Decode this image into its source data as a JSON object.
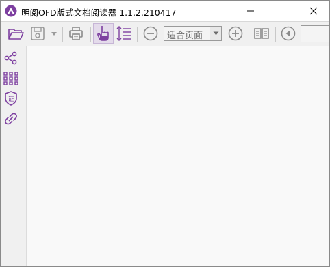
{
  "window": {
    "title": "明阅OFD版式文档阅读器 1.1.2.210417"
  },
  "toolbar": {
    "zoom": {
      "selected": "适合页面"
    },
    "page_number": ""
  },
  "icons": {
    "app": "app-logo-icon",
    "open": "open-folder-icon",
    "save": "save-icon",
    "print": "print-icon",
    "hand": "hand-tool-icon",
    "select_text": "text-select-icon",
    "zoom_out": "zoom-out-icon",
    "zoom_in": "zoom-in-icon",
    "book": "book-view-icon",
    "prev": "previous-page-icon",
    "share": "share-icon",
    "thumbnails": "thumbnails-icon",
    "certificate": "certificate-icon",
    "link": "link-icon"
  },
  "colors": {
    "accent": "#7d3fa0",
    "toolbar_bg": "#f0f0f0",
    "doc_bg": "#f9f9f9"
  }
}
